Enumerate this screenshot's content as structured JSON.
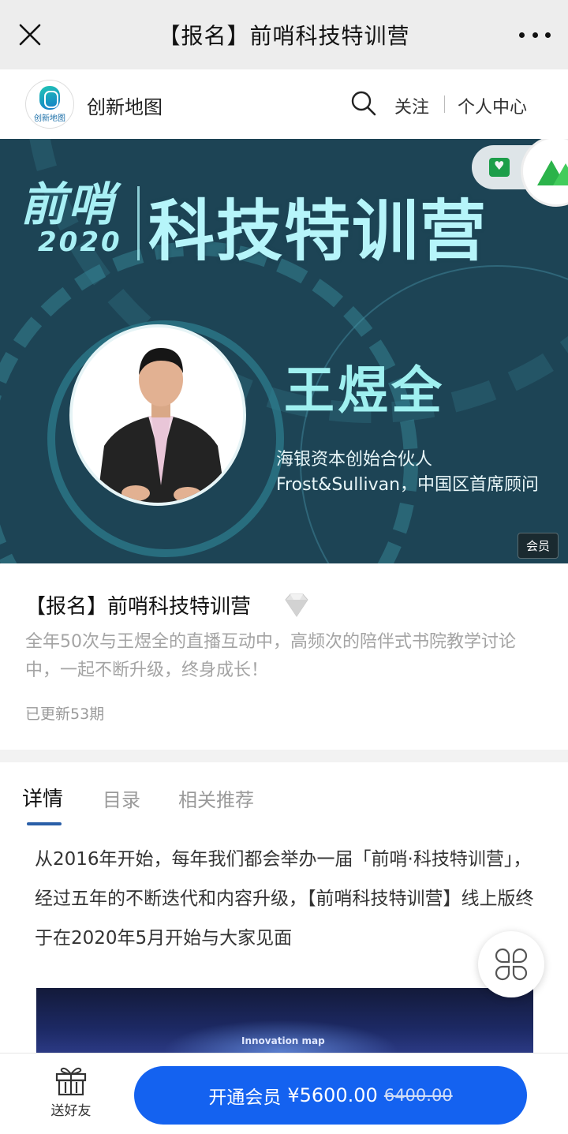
{
  "window": {
    "title": "【报名】前哨科技特训营"
  },
  "account": {
    "logo_text": "创新地图",
    "name": "创新地图",
    "follow": "关注",
    "personal_center": "个人中心"
  },
  "banner": {
    "brand_top": "前哨",
    "brand_year": "2020",
    "headline": "科技特训营",
    "speaker": "王煜全",
    "role_1": "海银资本创始合伙人",
    "role_2": "Frost&Sullivan，中国区首席顾问",
    "badge": "会员"
  },
  "course": {
    "title": "【报名】前哨科技特训营",
    "description": "全年50次与王煜全的直播互动中，高频次的陪伴式书院教学讨论中，一起不断升级，终身成长！",
    "updated": "已更新53期"
  },
  "tabs": [
    {
      "label": "详情",
      "active": true
    },
    {
      "label": "目录",
      "active": false
    },
    {
      "label": "相关推荐",
      "active": false
    }
  ],
  "article": {
    "paragraph": "从2016年开始，每年我们都会举办一届「前哨·科技特训营」，经过五年的不断迭代和内容升级，【前哨科技特训营】线上版终于在2020年5月开始与大家见面",
    "photo_logo": "Innovation map"
  },
  "bottom": {
    "gift_label": "送好友",
    "buy_label": "开通会员",
    "price": "¥5600.00",
    "original_price": "6400.00"
  },
  "colors": {
    "accent": "#1462f0",
    "banner_bg": "#1d4455",
    "tab_underline": "#2a5fa8"
  }
}
